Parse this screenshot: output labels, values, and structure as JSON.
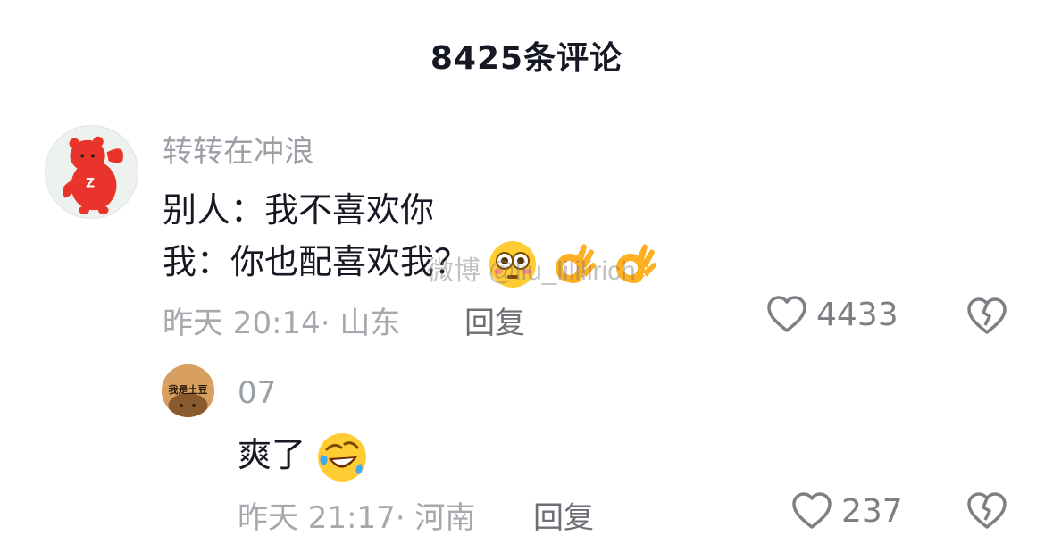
{
  "header": {
    "title": "8425条评论"
  },
  "comments": [
    {
      "username": "转转在冲浪",
      "lines": [
        "别人：我不喜欢你",
        "我：你也配喜欢我？"
      ],
      "time": "昨天 20:14",
      "location": "· 山东",
      "reply_label": "回复",
      "likes": "4433",
      "emojis": [
        "flushed-face",
        "ok-hand",
        "ok-hand"
      ]
    },
    {
      "username": "07",
      "avatar_text": "我是土豆",
      "lines": [
        "爽了"
      ],
      "time": "昨天 21:17",
      "location": "· 河南",
      "reply_label": "回复",
      "likes": "237",
      "emojis": [
        "rolling-laughing-face"
      ]
    }
  ],
  "watermark": "微博 @liu_lililirich",
  "colors": {
    "text": "#161823",
    "muted": "#a6a8ad",
    "avatar_red": "#e8342a"
  }
}
